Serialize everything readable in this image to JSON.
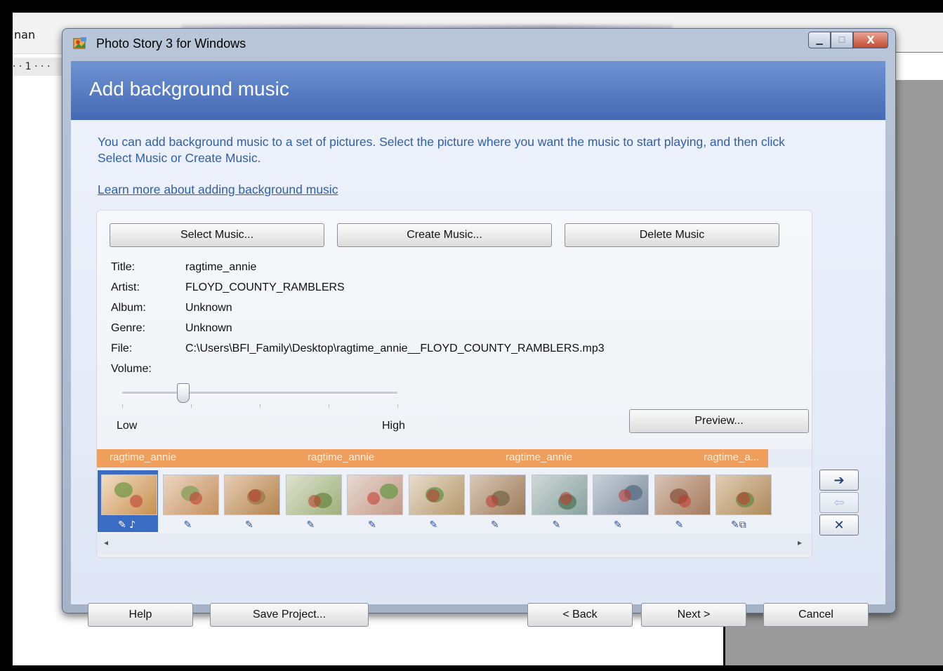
{
  "background": {
    "doc_text": "nan",
    "ruler_text": "· · 1 · · ·"
  },
  "window": {
    "title": "Photo Story 3 for Windows",
    "close_glyph": "X",
    "min_glyph": "▁",
    "max_glyph": "☐"
  },
  "header": {
    "title": "Add background music"
  },
  "content": {
    "instructions": "You can add background music to a set of pictures.  Select the picture where you want the music to start playing, and then click Select Music or Create Music.",
    "learn_link": "Learn more about adding background music"
  },
  "music_buttons": {
    "select": "Select Music...",
    "create": "Create Music...",
    "delete": "Delete Music"
  },
  "metadata": {
    "title_label": "Title:",
    "title_value": "ragtime_annie",
    "artist_label": "Artist:",
    "artist_value": "FLOYD_COUNTY_RAMBLERS",
    "album_label": "Album:",
    "album_value": "Unknown",
    "genre_label": "Genre:",
    "genre_value": "Unknown",
    "file_label": "File:",
    "file_value": "C:\\Users\\BFI_Family\\Desktop\\ragtime_annie__FLOYD_COUNTY_RAMBLERS.mp3",
    "volume_label": "Volume:"
  },
  "volume": {
    "low_label": "Low",
    "high_label": "High",
    "level": 0.22
  },
  "preview_button": "Preview...",
  "music_track": {
    "labels": [
      "ragtime_annie",
      "ragtime_annie",
      "ragtime_annie",
      "ragtime_a..."
    ]
  },
  "filmstrip": {
    "count": 11,
    "selected_index": 0,
    "edit_icon": "✎",
    "music_note_icon": "♪",
    "transition_icon": "⧉"
  },
  "side_buttons": {
    "right_arrow": "➔",
    "left_arrow": "⇦",
    "remove": "✕"
  },
  "footer": {
    "help": "Help",
    "save": "Save Project...",
    "back": "< Back",
    "next": "Next >",
    "cancel": "Cancel"
  }
}
